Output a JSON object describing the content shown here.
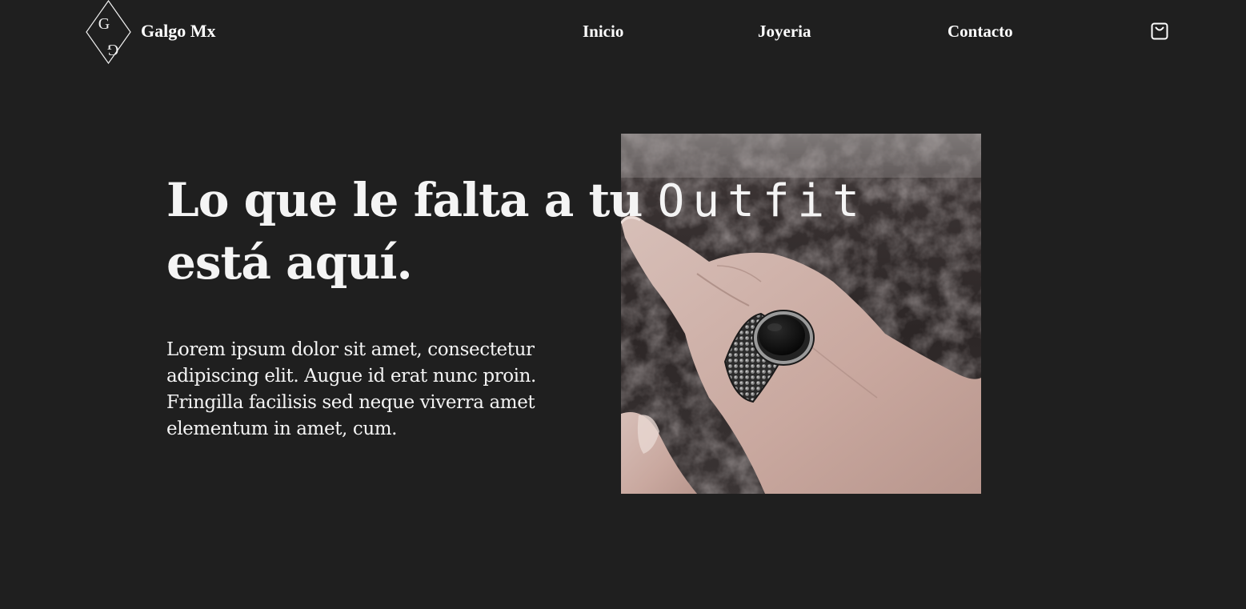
{
  "header": {
    "logo_monogram": "GG",
    "brand_name": "Galgo Mx",
    "nav": {
      "inicio": "Inicio",
      "joyeria": "Joyeria",
      "contacto": "Contacto"
    },
    "cart_icon": "shopping-bag-icon"
  },
  "hero": {
    "title_line1": "Lo que le falta a tu",
    "title_accent": "Outfit",
    "title_line2": "está aquí.",
    "description": "Lorem ipsum dolor sit amet, consectetur adipiscing elit. Augue id erat nunc proin. Fringilla facilisis sed neque viverra amet elementum in amet, cum.",
    "image_subject": "hand-with-black-signet-ring"
  },
  "colors": {
    "background": "#1f1f1f",
    "text": "#f4f4f4"
  }
}
